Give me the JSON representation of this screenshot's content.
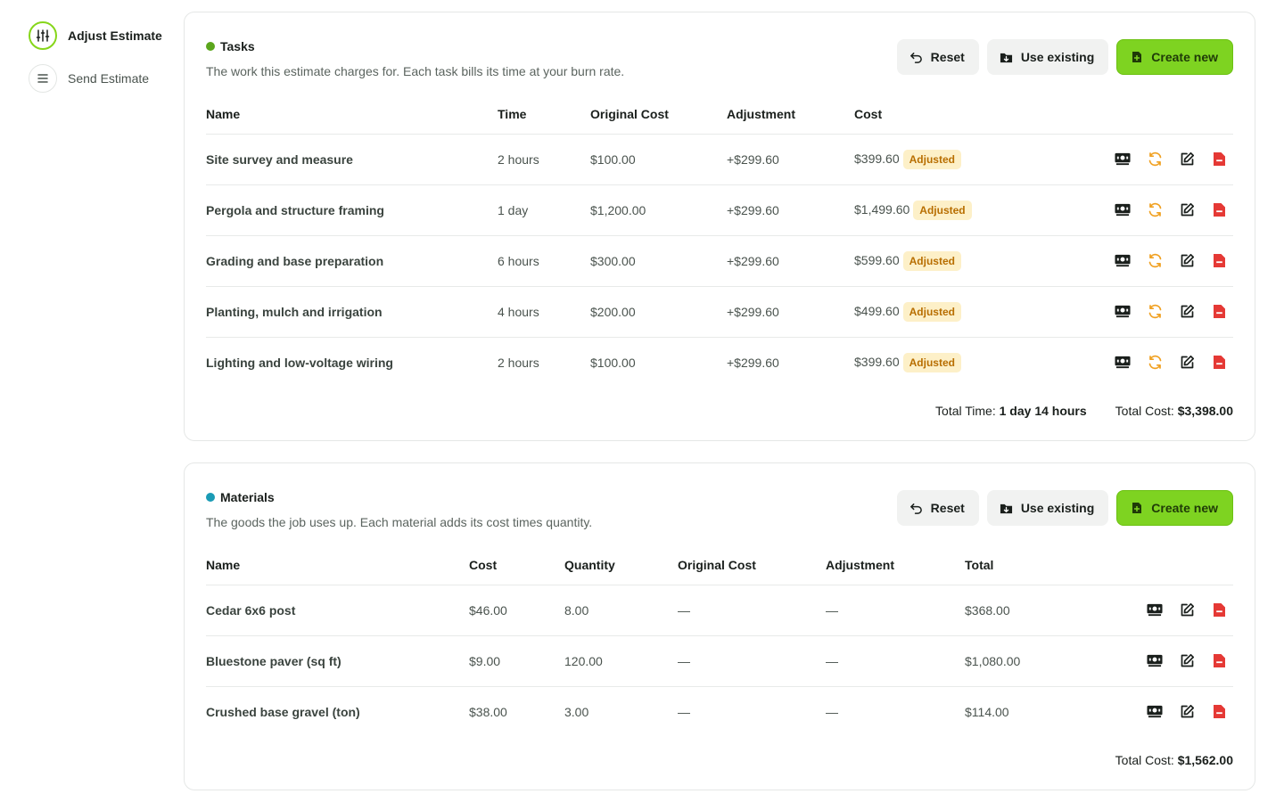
{
  "stepper": {
    "steps": [
      {
        "label": "Adjust Estimate",
        "active": true
      },
      {
        "label": "Send Estimate",
        "active": false
      }
    ]
  },
  "tasks": {
    "title": "Tasks",
    "dot_color": "#5ba61c",
    "description": "The work this estimate charges for. Each task bills its time at your burn rate.",
    "buttons": {
      "reset": "Reset",
      "use_existing": "Use existing",
      "create_new": "Create new"
    },
    "columns": {
      "name": "Name",
      "time": "Time",
      "original_cost": "Original Cost",
      "adjustment": "Adjustment",
      "cost": "Cost"
    },
    "rows": [
      {
        "name": "Site survey and measure",
        "time": "2 hours",
        "original_cost": "$100.00",
        "adjustment": "+$299.60",
        "cost": "$399.60",
        "badge": "Adjusted"
      },
      {
        "name": "Pergola and structure framing",
        "time": "1 day",
        "original_cost": "$1,200.00",
        "adjustment": "+$299.60",
        "cost": "$1,499.60",
        "badge": "Adjusted"
      },
      {
        "name": "Grading and base preparation",
        "time": "6 hours",
        "original_cost": "$300.00",
        "adjustment": "+$299.60",
        "cost": "$599.60",
        "badge": "Adjusted"
      },
      {
        "name": "Planting, mulch and irrigation",
        "time": "4 hours",
        "original_cost": "$200.00",
        "adjustment": "+$299.60",
        "cost": "$499.60",
        "badge": "Adjusted"
      },
      {
        "name": "Lighting and low-voltage wiring",
        "time": "2 hours",
        "original_cost": "$100.00",
        "adjustment": "+$299.60",
        "cost": "$399.60",
        "badge": "Adjusted"
      }
    ],
    "total_time_label": "Total Time:",
    "total_time": "1 day 14 hours",
    "total_cost_label": "Total Cost:",
    "total_cost": "$3,398.00"
  },
  "materials": {
    "title": "Materials",
    "dot_color": "#1a9bb5",
    "description": "The goods the job uses up. Each material adds its cost times quantity.",
    "buttons": {
      "reset": "Reset",
      "use_existing": "Use existing",
      "create_new": "Create new"
    },
    "columns": {
      "name": "Name",
      "cost": "Cost",
      "quantity": "Quantity",
      "original_cost": "Original Cost",
      "adjustment": "Adjustment",
      "total": "Total"
    },
    "rows": [
      {
        "name": "Cedar 6x6 post",
        "cost": "$46.00",
        "quantity": "8.00",
        "original_cost": "—",
        "adjustment": "—",
        "total": "$368.00"
      },
      {
        "name": "Bluestone paver (sq ft)",
        "cost": "$9.00",
        "quantity": "120.00",
        "original_cost": "—",
        "adjustment": "—",
        "total": "$1,080.00"
      },
      {
        "name": "Crushed base gravel (ton)",
        "cost": "$38.00",
        "quantity": "3.00",
        "original_cost": "—",
        "adjustment": "—",
        "total": "$114.00"
      }
    ],
    "total_cost_label": "Total Cost:",
    "total_cost": "$1,562.00"
  },
  "colors": {
    "accent": "#7ed321",
    "badge_bg": "#fdf0c8",
    "badge_text": "#b86e00",
    "delete": "#e53935",
    "refresh": "#f0a020"
  },
  "icons": {
    "step1": "sliders-icon",
    "step2": "list-icon",
    "reset": "undo-icon",
    "use_existing": "folder-download-icon",
    "create_new": "file-plus-icon",
    "row": [
      "money-icon",
      "refresh-icon",
      "edit-icon",
      "delete-file-icon"
    ]
  }
}
